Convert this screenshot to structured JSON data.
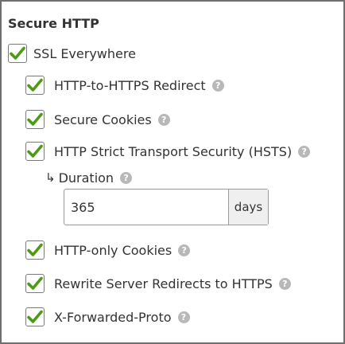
{
  "section": {
    "title": "Secure HTTP"
  },
  "colors": {
    "check": "#4e9a13",
    "help_icon_bg": "#b8b8b8"
  },
  "ssl_everywhere": {
    "label": "SSL Everywhere",
    "checked": true
  },
  "options": [
    {
      "label": "HTTP-to-HTTPS Redirect",
      "checked": true,
      "help_icon": "help-icon"
    },
    {
      "label": "Secure Cookies",
      "checked": true,
      "help_icon": "help-icon"
    },
    {
      "label": "HTTP Strict Transport Security (HSTS)",
      "checked": true,
      "help_icon": "help-icon"
    },
    {
      "label": "HTTP-only Cookies",
      "checked": true,
      "help_icon": "help-icon"
    },
    {
      "label": "Rewrite Server Redirects to HTTPS",
      "checked": true,
      "help_icon": "help-icon"
    },
    {
      "label": "X-Forwarded-Proto",
      "checked": true,
      "help_icon": "help-icon"
    }
  ],
  "duration": {
    "arrow": "↳",
    "label": "Duration",
    "value": "365",
    "unit": "days"
  },
  "help_glyph": "?"
}
